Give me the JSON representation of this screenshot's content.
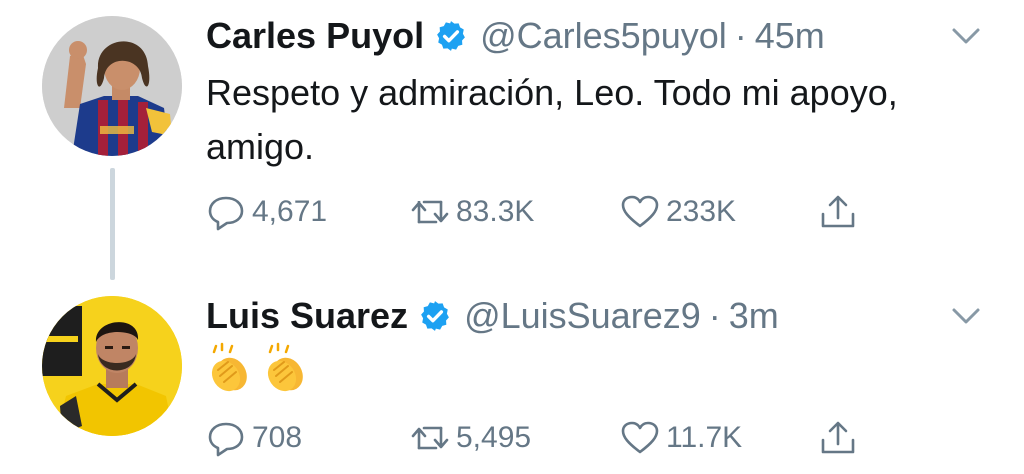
{
  "tweets": [
    {
      "display_name": "Carles Puyol",
      "handle": "@Carles5puyol",
      "separator": "·",
      "time": "45m",
      "text": "Respeto y admiración, Leo. Todo mi apoyo, amigo.",
      "replies": "4,671",
      "retweets": "83.3K",
      "likes": "233K",
      "icons": {
        "avatar": "avatar-photo",
        "verified": "verified-badge-icon",
        "more": "chevron-down-icon",
        "reply": "reply-icon",
        "retweet": "retweet-icon",
        "like": "heart-icon",
        "share": "share-icon"
      }
    },
    {
      "display_name": "Luis Suarez",
      "handle": "@LuisSuarez9",
      "separator": "·",
      "time": "3m",
      "text_emojis": [
        "clapping-hands-emoji",
        "clapping-hands-emoji"
      ],
      "replies": "708",
      "retweets": "5,495",
      "likes": "11.7K",
      "icons": {
        "avatar": "avatar-photo",
        "verified": "verified-badge-icon",
        "more": "chevron-down-icon",
        "reply": "reply-icon",
        "retweet": "retweet-icon",
        "like": "heart-icon",
        "share": "share-icon"
      }
    }
  ],
  "colors": {
    "verified_blue": "#1da1f2",
    "secondary_text": "#657786",
    "primary_text": "#14171a",
    "thread_line": "#ccd6dd"
  }
}
